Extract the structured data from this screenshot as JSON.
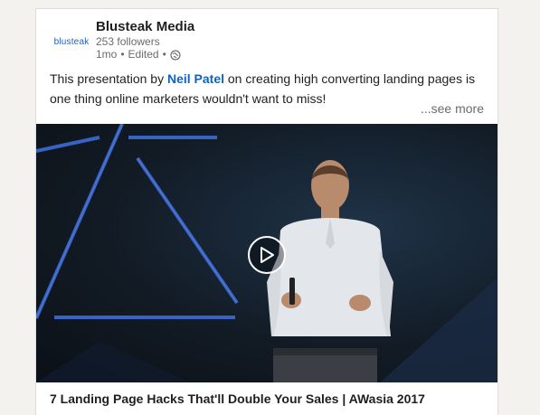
{
  "post": {
    "company": {
      "logo_text": "blusteak",
      "name": "Blusteak Media",
      "followers": "253 followers",
      "time": "1mo",
      "edited": "Edited",
      "separator": "•",
      "visibility_icon": "globe-icon"
    },
    "text": {
      "before": "This presentation by ",
      "mention": "Neil Patel",
      "after": " on creating high converting landing pages is one thing online marketers wouldn't want to miss!"
    },
    "see_more": "...see more",
    "video": {
      "play_icon": "play-icon",
      "title": "7 Landing Page Hacks That'll Double Your Sales | AWasia 2017"
    }
  },
  "colors": {
    "accent": "#0a66c2",
    "text": "#1f1f1f",
    "muted": "#6b6b6b"
  }
}
